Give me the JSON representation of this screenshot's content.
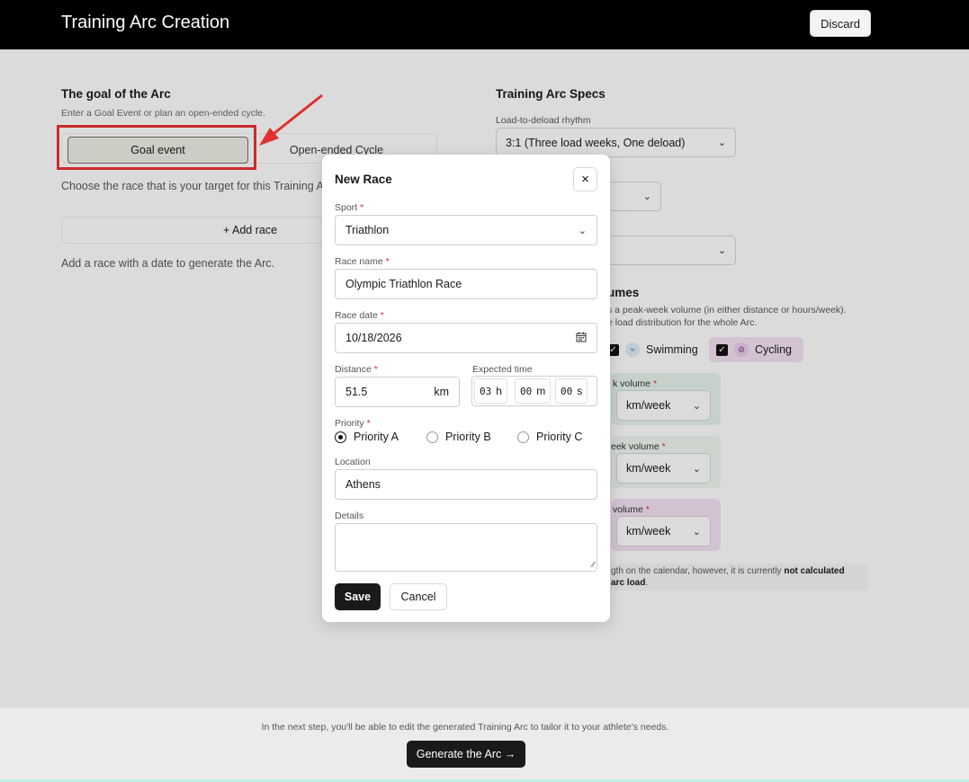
{
  "header": {
    "title": "Training Arc Creation",
    "discard_label": "Discard"
  },
  "goal": {
    "heading": "The goal of the Arc",
    "subtitle": "Enter a Goal Event or plan an open-ended cycle.",
    "options": [
      "Goal event",
      "Open-ended Cycle"
    ],
    "selected": "Goal event",
    "choose_text": "Choose the race that is your target for this Training A",
    "add_race_label": "+ Add race",
    "add_hint": "Add a race with a date to generate the Arc."
  },
  "specs": {
    "heading": "Training Arc Specs",
    "rhythm_label": "Load-to-deload rhythm",
    "rhythm_value": "3:1 (Three load weeks, One deload)"
  },
  "volumes": {
    "heading_fragment": "umes",
    "sub_line1": "s a peak-week volume (in either distance or hours/week).",
    "sub_line2": "e load distribution for the whole Arc.",
    "sports": [
      {
        "label": "Swimming",
        "checked": true
      },
      {
        "label": "Cycling",
        "checked": true
      }
    ],
    "cards": [
      {
        "label_fragment": "k volume",
        "unit": "km/week"
      },
      {
        "label_fragment": "eek volume",
        "unit": "km/week"
      },
      {
        "label_fragment": "volume",
        "unit": "km/week"
      }
    ],
    "note_part1": "gth on the calendar, however, it is currently ",
    "note_bold1": "not calculated",
    "note_bold2": "arc load",
    "note_end": "."
  },
  "footer": {
    "hint": "In the next step, you'll be able to edit the generated Training Arc to tailor it to your athlete's needs.",
    "generate_label": "Generate the Arc →"
  },
  "modal": {
    "title": "New Race",
    "close_glyph": "×",
    "sport_label": "Sport",
    "sport_value": "Triathlon",
    "race_name_label": "Race name",
    "race_name_value": "Olympic Triathlon Race",
    "race_date_label": "Race date",
    "race_date_value": "10/18/2026",
    "distance_label": "Distance",
    "distance_value": "51.5",
    "distance_unit": "km",
    "expected_time_label": "Expected time",
    "time": {
      "h": "03",
      "m": "00",
      "s": "00",
      "h_unit": "h",
      "m_unit": "m",
      "s_unit": "s"
    },
    "priority_label": "Priority",
    "priorities": [
      "Priority A",
      "Priority B",
      "Priority C"
    ],
    "priority_selected": "Priority A",
    "location_label": "Location",
    "location_value": "Athens",
    "details_label": "Details",
    "details_value": "",
    "required_mark": "*",
    "save_label": "Save",
    "cancel_label": "Cancel"
  },
  "colors": {
    "topbar": "#000000",
    "highlight": "#e0312f",
    "selected_option_bg": "#e2e6dc",
    "swimming_bg": "#dde9e3",
    "cycling_bg": "#ead9ea",
    "primary_button": "#1a1a1a"
  },
  "icons": {
    "select_chevron": "chevron-down-icon",
    "date": "calendar-icon",
    "close": "close-icon",
    "swimming": "swimmer-icon",
    "cycling": "cyclist-icon",
    "annotation": "red-arrow-icon"
  }
}
